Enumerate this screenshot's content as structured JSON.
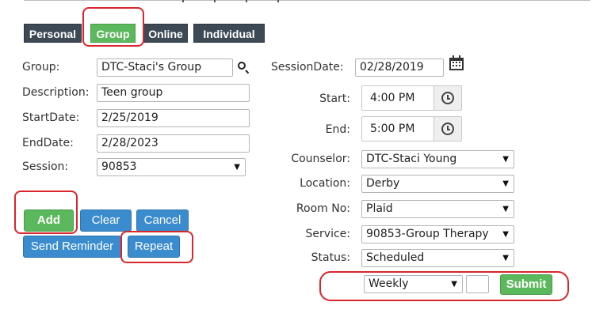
{
  "tabs": [
    {
      "label": "Personal",
      "active": false
    },
    {
      "label": "Group",
      "active": true
    },
    {
      "label": "Online",
      "active": false
    },
    {
      "label": "Individual",
      "active": false
    }
  ],
  "left_form": {
    "group": {
      "label": "Group:",
      "value": "DTC-Staci's Group"
    },
    "description": {
      "label": "Description:",
      "value": "Teen group"
    },
    "start_date": {
      "label": "StartDate:",
      "value": "2/25/2019"
    },
    "end_date": {
      "label": "EndDate:",
      "value": "2/28/2023"
    },
    "session": {
      "label": "Session:",
      "value": "90853"
    }
  },
  "right_form": {
    "session_date": {
      "label": "SessionDate:",
      "value": "02/28/2019"
    },
    "start": {
      "label": "Start:",
      "value": "4:00 PM"
    },
    "end": {
      "label": "End:",
      "value": "5:00 PM"
    },
    "counselor": {
      "label": "Counselor:",
      "value": "DTC-Staci Young"
    },
    "location": {
      "label": "Location:",
      "value": "Derby"
    },
    "room_no": {
      "label": "Room No:",
      "value": "Plaid"
    },
    "service": {
      "label": "Service:",
      "value": "90853-Group Therapy"
    },
    "status": {
      "label": "Status:",
      "value": "Scheduled"
    }
  },
  "buttons": {
    "add": "Add",
    "clear": "Clear",
    "cancel": "Cancel",
    "send_reminder": "Send Reminder",
    "repeat": "Repeat"
  },
  "repeat_row": {
    "frequency": "Weekly",
    "count": "",
    "submit": "Submit"
  },
  "colors": {
    "tab_dark": "#3d4a56",
    "tab_active": "#5cb85c",
    "button_green": "#5cb85c",
    "button_blue": "#3b8ccf",
    "annotation_red": "#d9252c"
  },
  "icons": {
    "group_search": "search-icon",
    "session_date_picker": "calendar-icon",
    "time_picker": "clock-icon",
    "dropdown": "chevron-down-icon"
  }
}
